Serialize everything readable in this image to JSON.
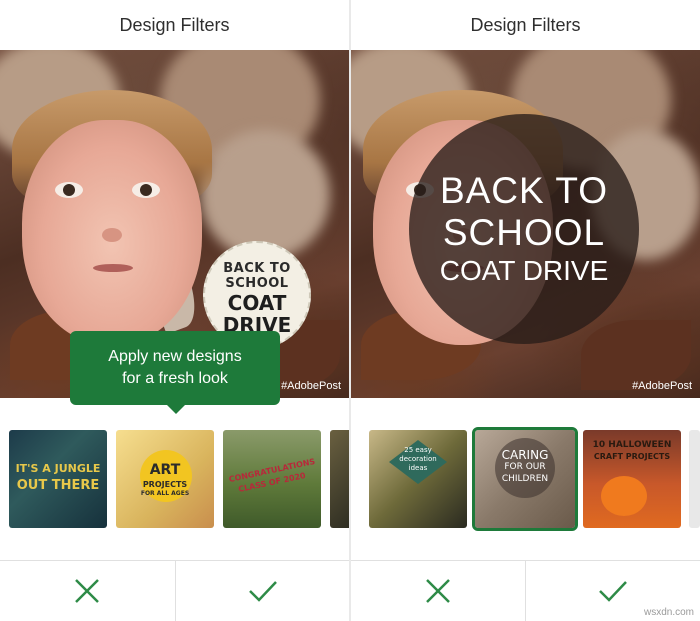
{
  "left_panel": {
    "title": "Design Filters",
    "badge": {
      "line1": "BACK TO",
      "line2": "SCHOOL",
      "line3": "COAT",
      "line4": "DRIVE"
    },
    "hashtag": "#AdobePost",
    "tooltip": {
      "line1": "Apply new designs",
      "line2": "for a fresh look"
    },
    "thumbnails": [
      {
        "name": "jungle",
        "text1": "IT'S A JUNGLE",
        "text2": "OUT THERE"
      },
      {
        "name": "art",
        "text1": "ART",
        "text2": "PROJECTS",
        "text3": "FOR ALL AGES"
      },
      {
        "name": "congrats",
        "text1": "CONGRATULATIONS",
        "text2": "CLASS OF 2020"
      },
      {
        "name": "partial",
        "text1": ""
      }
    ],
    "actions": {
      "cancel": "cancel",
      "confirm": "confirm"
    }
  },
  "right_panel": {
    "title": "Design Filters",
    "badge": {
      "line1": "BACK TO",
      "line2": "SCHOOL",
      "line3": "COAT DRIVE"
    },
    "hashtag": "#AdobePost",
    "thumbnails": [
      {
        "name": "decoration",
        "text1": "25 easy",
        "text2": "decoration",
        "text3": "ideas"
      },
      {
        "name": "caring",
        "text1": "CARING",
        "text2": "FOR OUR",
        "text3": "CHILDREN",
        "selected": true
      },
      {
        "name": "halloween",
        "text1": "10 HALLOWEEN",
        "text2": "CRAFT PROJECTS"
      }
    ],
    "actions": {
      "cancel": "cancel",
      "confirm": "confirm"
    }
  },
  "watermark": "wsxdn.com",
  "colors": {
    "accent": "#1e7a3a",
    "tooltip_bg": "#1e7a3a",
    "icon": "#2e8b47"
  }
}
